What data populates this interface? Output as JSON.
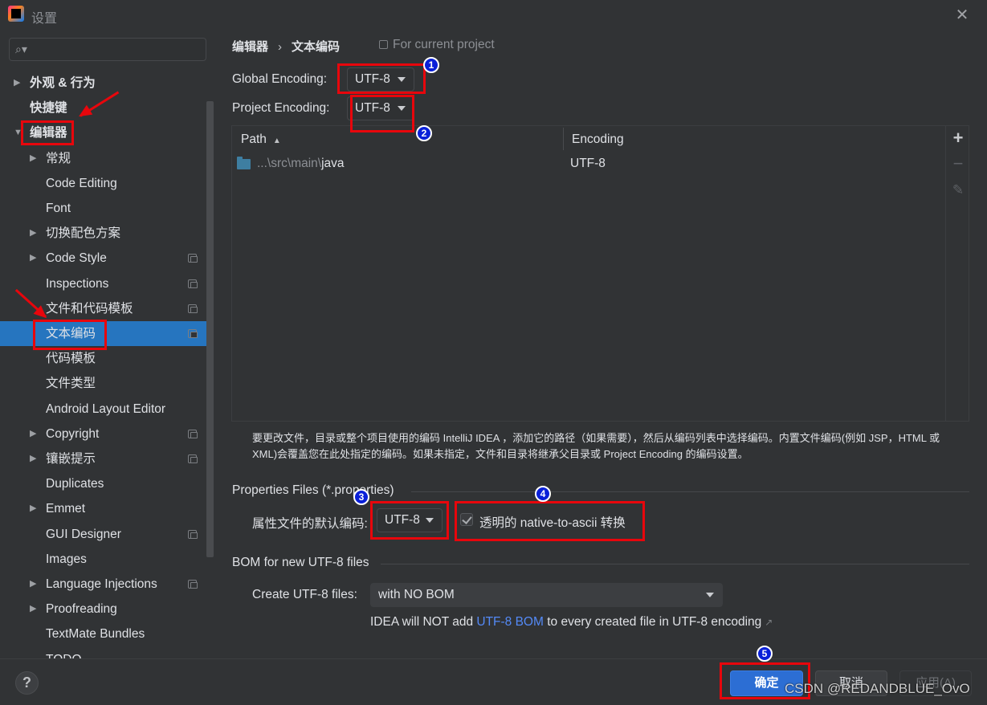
{
  "window": {
    "title": "设置",
    "close_icon": "close-icon"
  },
  "sidebar": {
    "search_placeholder": "",
    "items": [
      {
        "label": "外观 & 行为",
        "expandable": true,
        "expanded": false,
        "bold": true,
        "level": 0,
        "project": false
      },
      {
        "label": "快捷键",
        "expandable": false,
        "bold": true,
        "level": 0,
        "project": false
      },
      {
        "label": "编辑器",
        "expandable": true,
        "expanded": true,
        "bold": true,
        "level": 0,
        "project": false
      },
      {
        "label": "常规",
        "expandable": true,
        "expanded": false,
        "level": 1,
        "project": false
      },
      {
        "label": "Code Editing",
        "expandable": false,
        "level": 1,
        "project": false
      },
      {
        "label": "Font",
        "expandable": false,
        "level": 1,
        "project": false
      },
      {
        "label": "切换配色方案",
        "expandable": true,
        "expanded": false,
        "level": 1,
        "project": false
      },
      {
        "label": "Code Style",
        "expandable": true,
        "expanded": false,
        "level": 1,
        "project": true
      },
      {
        "label": "Inspections",
        "expandable": false,
        "level": 1,
        "project": true
      },
      {
        "label": "文件和代码模板",
        "expandable": false,
        "level": 1,
        "project": true
      },
      {
        "label": "文本编码",
        "expandable": false,
        "level": 1,
        "project": true,
        "selected": true
      },
      {
        "label": "代码模板",
        "expandable": false,
        "level": 1,
        "project": false
      },
      {
        "label": "文件类型",
        "expandable": false,
        "level": 1,
        "project": false
      },
      {
        "label": "Android Layout Editor",
        "expandable": false,
        "level": 1,
        "project": false
      },
      {
        "label": "Copyright",
        "expandable": true,
        "expanded": false,
        "level": 1,
        "project": true
      },
      {
        "label": "镶嵌提示",
        "expandable": true,
        "expanded": false,
        "level": 1,
        "project": true
      },
      {
        "label": "Duplicates",
        "expandable": false,
        "level": 1,
        "project": false
      },
      {
        "label": "Emmet",
        "expandable": true,
        "expanded": false,
        "level": 1,
        "project": false
      },
      {
        "label": "GUI Designer",
        "expandable": false,
        "level": 1,
        "project": true
      },
      {
        "label": "Images",
        "expandable": false,
        "level": 1,
        "project": false
      },
      {
        "label": "Language Injections",
        "expandable": true,
        "expanded": false,
        "level": 1,
        "project": true
      },
      {
        "label": "Proofreading",
        "expandable": true,
        "expanded": false,
        "level": 1,
        "project": false
      },
      {
        "label": "TextMate Bundles",
        "expandable": false,
        "level": 1,
        "project": false
      },
      {
        "label": "TODO",
        "expandable": false,
        "level": 1,
        "project": false
      }
    ]
  },
  "breadcrumb": {
    "parent": "编辑器",
    "separator": "›",
    "current": "文本编码",
    "scope": "For current project"
  },
  "encoding": {
    "global_label": "Global Encoding:",
    "global_value": "UTF-8",
    "project_label": "Project Encoding:",
    "project_value": "UTF-8"
  },
  "table": {
    "columns": [
      "Path",
      "Encoding"
    ],
    "sort_indicator": "▲",
    "rows": [
      {
        "path_prefix": "...\\src\\main\\",
        "path_name": "java",
        "encoding": "UTF-8"
      }
    ],
    "toolbar": {
      "add": "+",
      "remove": "−",
      "edit": "✎"
    }
  },
  "description": "要更改文件，目录或整个项目使用的编码 IntelliJ IDEA ，添加它的路径（如果需要），然后从编码列表中选择编码。内置文件编码(例如 JSP，HTML 或 XML)会覆盖您在此处指定的编码。如果未指定，文件和目录将继承父目录或 Project Encoding 的编码设置。",
  "properties": {
    "section_title": "Properties Files (*.properties)",
    "default_label": "属性文件的默认编码:",
    "default_value": "UTF-8",
    "native_to_ascii_label": "透明的 native-to-ascii 转换",
    "native_to_ascii_checked": true
  },
  "bom": {
    "section_title": "BOM for new UTF-8 files",
    "create_label": "Create UTF-8 files:",
    "create_value": "with NO BOM",
    "note_before": "IDEA will NOT add ",
    "note_link": "UTF-8 BOM",
    "note_after": " to every created file in UTF-8 encoding",
    "note_ext_icon": "↗"
  },
  "footer": {
    "help": "?",
    "ok": "确定",
    "cancel": "取消",
    "apply": "应用(A)"
  },
  "annotations": {
    "badges": [
      "1",
      "2",
      "3",
      "4",
      "5"
    ],
    "color": "#e8060c",
    "badge_color": "#0a20d8"
  },
  "watermark": "CSDN @REDANDBLUE_OvO"
}
